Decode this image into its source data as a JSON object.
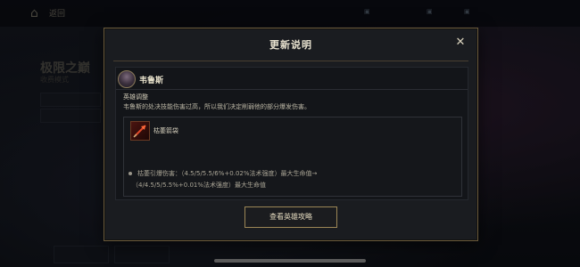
{
  "background": {
    "back_label": "返回",
    "top_chips": [
      "",
      "",
      ""
    ],
    "mode_title": "极限之巅",
    "mode_subtitle": "收费模式"
  },
  "modal": {
    "title": "更新说明",
    "close_icon": "close-icon",
    "hero": {
      "name": "韦鲁斯"
    },
    "adjustment": {
      "heading": "英雄调整",
      "description": "韦鲁斯的处决技能伤害过高，所以我们决定削弱他的部分爆发伤害。"
    },
    "ability": {
      "name": "枯萎箭袋",
      "changes": [
        "枯萎引爆伤害：（4.5/5/5.5/6%+0.02%法术强度）最大生命值→",
        "（4/4.5/5/5.5%+0.01%法术强度）最大生命值"
      ]
    },
    "guide_button": "查看英雄攻略"
  },
  "colors": {
    "accent_border": "#9c8656",
    "modal_bg": "#1a1c20"
  }
}
